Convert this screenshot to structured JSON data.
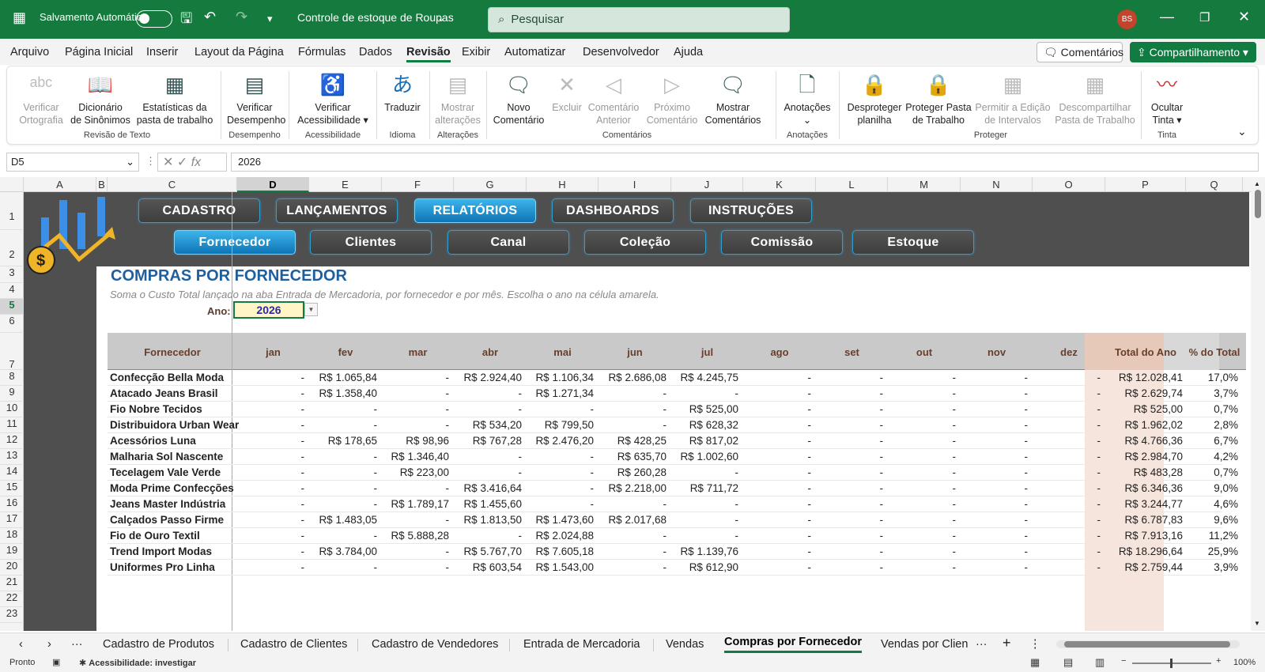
{
  "titlebar": {
    "autosave_label": "Salvamento Automático",
    "workbook_name": "Controle de estoque de Roupas",
    "search_placeholder": "Pesquisar",
    "user_initials": "BS"
  },
  "menu": [
    "Arquivo",
    "Página Inicial",
    "Inserir",
    "Layout da Página",
    "Fórmulas",
    "Dados",
    "Revisão",
    "Exibir",
    "Automatizar",
    "Desenvolvedor",
    "Ajuda"
  ],
  "menu_right": {
    "comments": "Comentários",
    "share": "Compartilhamento"
  },
  "ribbon": {
    "b1": "Verificar",
    "b1b": "Ortografia",
    "b2": "Dicionário",
    "b2b": "de Sinônimos",
    "b3": "Estatísticas da",
    "b3b": "pasta de trabalho",
    "g1": "Revisão de Texto",
    "b4": "Verificar",
    "b4b": "Desempenho",
    "g2": "Desempenho",
    "b5": "Verificar",
    "b5b": "Acessibilidade",
    "g3": "Acessibilidade",
    "b6": "Traduzir",
    "g4": "Idioma",
    "b7": "Mostrar",
    "b7b": "alterações",
    "g5": "Alterações",
    "b8": "Novo",
    "b8b": "Comentário",
    "b9": "Excluir",
    "b10": "Comentário",
    "b10b": "Anterior",
    "b11": "Próximo",
    "b11b": "Comentário",
    "b12": "Mostrar",
    "b12b": "Comentários",
    "g6": "Comentários",
    "b13": "Anotações",
    "g7": "Anotações",
    "b14": "Desproteger",
    "b14b": "planilha",
    "b15": "Proteger Pasta",
    "b15b": "de Trabalho",
    "b16": "Permitir a Edição",
    "b16b": "de Intervalos",
    "b17": "Descompartilhar",
    "b17b": "Pasta de Trabalho",
    "g8": "Proteger",
    "b18": "Ocultar",
    "b18b": "Tinta",
    "g9": "Tinta"
  },
  "formula": {
    "cell": "D5",
    "value": "2026",
    "fx": "fx"
  },
  "columns": [
    "A",
    "B",
    "C",
    "D",
    "E",
    "F",
    "G",
    "H",
    "I",
    "J",
    "K",
    "L",
    "M",
    "N",
    "O",
    "P",
    "Q"
  ],
  "rows": [
    "1",
    "2",
    "3",
    "4",
    "5",
    "6",
    "7",
    "8",
    "9",
    "10",
    "11",
    "12",
    "13",
    "14",
    "15",
    "16",
    "17",
    "18",
    "19",
    "20",
    "21",
    "22",
    "23"
  ],
  "nav_top": [
    "CADASTRO",
    "LANÇAMENTOS",
    "RELATÓRIOS",
    "DASHBOARDS",
    "INSTRUÇÕES"
  ],
  "nav_sub": [
    "Fornecedor",
    "Clientes",
    "Canal",
    "Coleção",
    "Comissão",
    "Estoque"
  ],
  "report": {
    "title": "COMPRAS POR FORNECEDOR",
    "subtitle": "Soma o Custo Total lançado na aba Entrada de Mercadoria, por fornecedor e por mês. Escolha o ano na célula amarela.",
    "year_label": "Ano:",
    "year": "2026"
  },
  "table": {
    "headers": [
      "Fornecedor",
      "jan",
      "fev",
      "mar",
      "abr",
      "mai",
      "jun",
      "jul",
      "ago",
      "set",
      "out",
      "nov",
      "dez",
      "Total do Ano",
      "% do Total"
    ],
    "rows": [
      [
        "Confecção Bella Moda",
        "-",
        "R$ 1.065,84",
        "-",
        "R$ 2.924,40",
        "R$ 1.106,34",
        "R$ 2.686,08",
        "R$ 4.245,75",
        "-",
        "-",
        "-",
        "-",
        "-",
        "R$ 12.028,41",
        "17,0%"
      ],
      [
        "Atacado Jeans Brasil",
        "-",
        "R$ 1.358,40",
        "-",
        "-",
        "R$ 1.271,34",
        "-",
        "-",
        "-",
        "-",
        "-",
        "-",
        "-",
        "R$ 2.629,74",
        "3,7%"
      ],
      [
        "Fio Nobre Tecidos",
        "-",
        "-",
        "-",
        "-",
        "-",
        "-",
        "R$ 525,00",
        "-",
        "-",
        "-",
        "-",
        "-",
        "R$ 525,00",
        "0,7%"
      ],
      [
        "Distribuidora Urban Wear",
        "-",
        "-",
        "-",
        "R$ 534,20",
        "R$ 799,50",
        "-",
        "R$ 628,32",
        "-",
        "-",
        "-",
        "-",
        "-",
        "R$ 1.962,02",
        "2,8%"
      ],
      [
        "Acessórios Luna",
        "-",
        "R$ 178,65",
        "R$ 98,96",
        "R$ 767,28",
        "R$ 2.476,20",
        "R$ 428,25",
        "R$ 817,02",
        "-",
        "-",
        "-",
        "-",
        "-",
        "R$ 4.766,36",
        "6,7%"
      ],
      [
        "Malharia Sol Nascente",
        "-",
        "-",
        "R$ 1.346,40",
        "-",
        "-",
        "R$ 635,70",
        "R$ 1.002,60",
        "-",
        "-",
        "-",
        "-",
        "-",
        "R$ 2.984,70",
        "4,2%"
      ],
      [
        "Tecelagem Vale Verde",
        "-",
        "-",
        "R$ 223,00",
        "-",
        "-",
        "R$ 260,28",
        "-",
        "-",
        "-",
        "-",
        "-",
        "-",
        "R$ 483,28",
        "0,7%"
      ],
      [
        "Moda Prime Confecções",
        "-",
        "-",
        "-",
        "R$ 3.416,64",
        "-",
        "R$ 2.218,00",
        "R$ 711,72",
        "-",
        "-",
        "-",
        "-",
        "-",
        "R$ 6.346,36",
        "9,0%"
      ],
      [
        "Jeans Master Indústria",
        "-",
        "-",
        "R$ 1.789,17",
        "R$ 1.455,60",
        "-",
        "-",
        "-",
        "-",
        "-",
        "-",
        "-",
        "-",
        "R$ 3.244,77",
        "4,6%"
      ],
      [
        "Calçados Passo Firme",
        "-",
        "R$ 1.483,05",
        "-",
        "R$ 1.813,50",
        "R$ 1.473,60",
        "R$ 2.017,68",
        "-",
        "-",
        "-",
        "-",
        "-",
        "-",
        "R$ 6.787,83",
        "9,6%"
      ],
      [
        "Fio de Ouro Textil",
        "-",
        "-",
        "R$ 5.888,28",
        "-",
        "R$ 2.024,88",
        "-",
        "-",
        "-",
        "-",
        "-",
        "-",
        "-",
        "R$ 7.913,16",
        "11,2%"
      ],
      [
        "Trend Import Modas",
        "-",
        "R$ 3.784,00",
        "-",
        "R$ 5.767,70",
        "R$ 7.605,18",
        "-",
        "R$ 1.139,76",
        "-",
        "-",
        "-",
        "-",
        "-",
        "R$ 18.296,64",
        "25,9%"
      ],
      [
        "Uniformes Pro Linha",
        "-",
        "-",
        "-",
        "R$ 603,54",
        "R$ 1.543,00",
        "-",
        "R$ 612,90",
        "-",
        "-",
        "-",
        "-",
        "-",
        "R$ 2.759,44",
        "3,9%"
      ]
    ]
  },
  "sheet_tabs": [
    "Cadastro de Produtos",
    "Cadastro de Clientes",
    "Cadastro de Vendedores",
    "Entrada de Mercadoria",
    "Vendas",
    "Compras por Fornecedor",
    "Vendas por Clien"
  ],
  "status": {
    "ready": "Pronto",
    "accessibility": "Acessibilidade: investigar",
    "zoom": "100%"
  }
}
